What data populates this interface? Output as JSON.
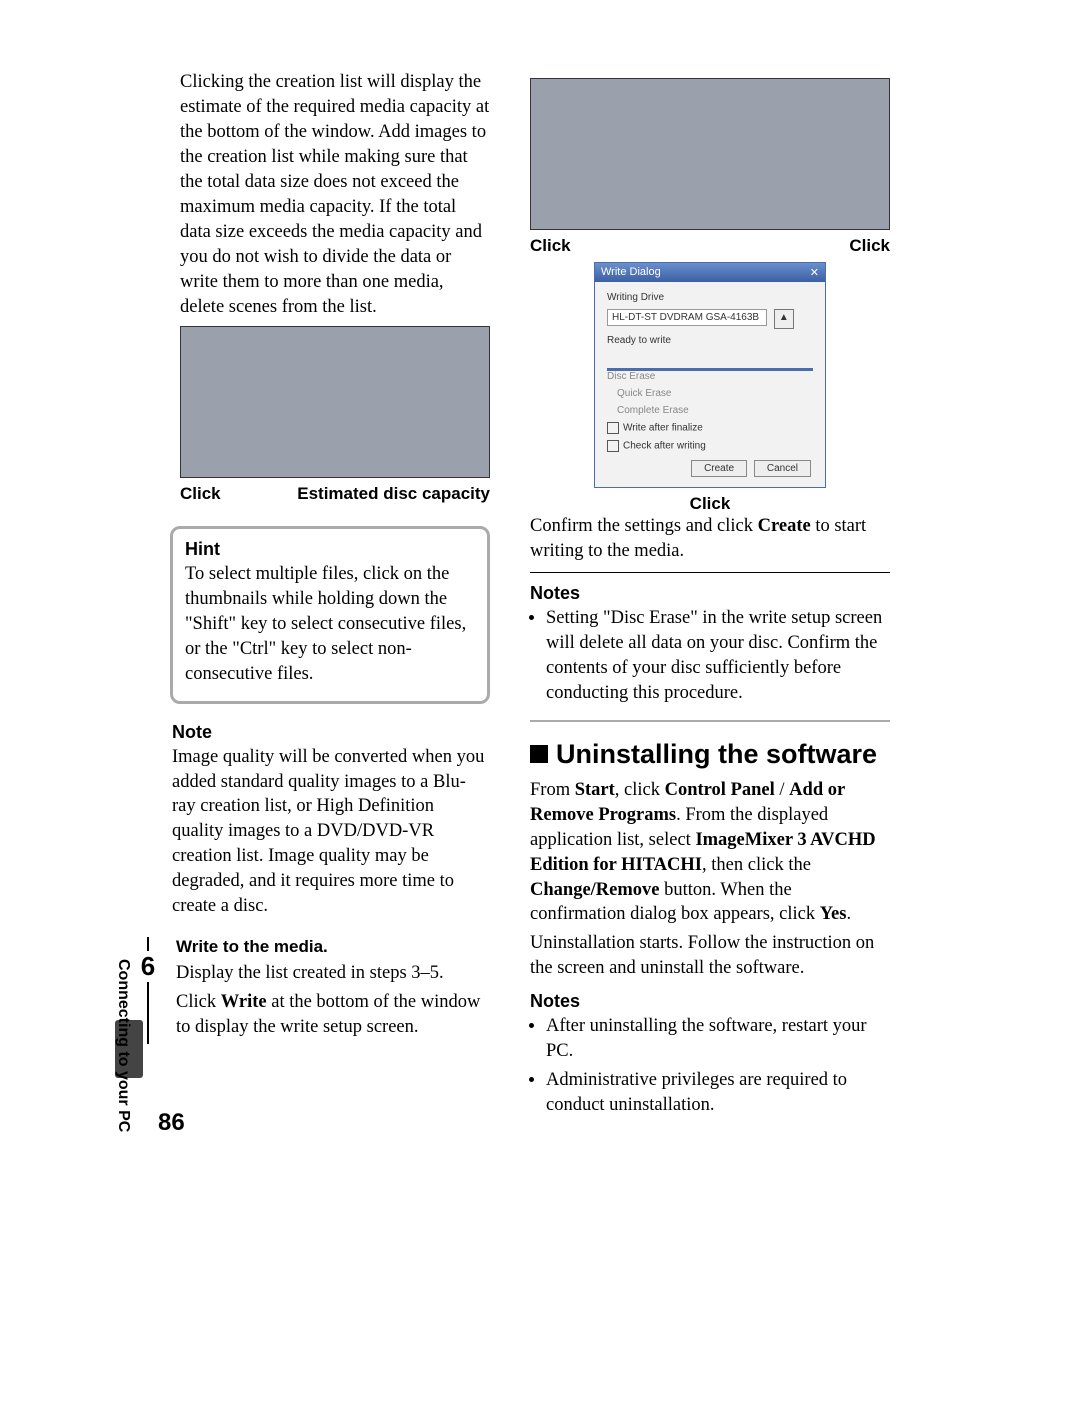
{
  "page_number": "86",
  "side_label": "Connecting to your PC",
  "left_column": {
    "intro": "Clicking the creation list will display the estimate of the required media capacity at the bottom of the window. Add images to the creation list while making sure that the total data size does not exceed the maximum media capacity. If the total data size exceeds the media capacity and you do not wish to divide the data or write them to more than one media, delete scenes from the list.",
    "fig1_caption_left": "Click",
    "fig1_caption_right": "Estimated disc capacity",
    "hint_title": "Hint",
    "hint_text": "To select multiple files, click on the thumbnails while holding down the \"Shift\" key to select consecutive files, or the \"Ctrl\" key to select non-consecutive files.",
    "note_title": "Note",
    "note_text": "Image quality will be converted when you added standard quality images to a Blu-ray creation list, or High Definition quality images to a DVD/DVD-VR creation list. Image quality may be degraded, and it requires more time to create a disc.",
    "step6_num": "6",
    "step6_title": "Write to the media.",
    "step6_line1": "Display the list created in steps 3–5.",
    "step6_line2a": "Click ",
    "step6_line2b": "Write",
    "step6_line2c": " at the bottom of the window to display the write setup screen."
  },
  "right_column": {
    "fig2_caption_left": "Click",
    "fig2_caption_right": "Click",
    "dialog_title": "Write Dialog",
    "dialog_label1": "Writing Drive",
    "dialog_drive": "HL-DT-ST DVDRAM GSA-4163B",
    "dialog_status": "Ready to write",
    "dialog_section": "Disc Erase",
    "dialog_opt1": "Quick Erase",
    "dialog_opt2": "Complete Erase",
    "dialog_cb1": "Write after finalize",
    "dialog_cb2": "Check after writing",
    "dialog_btn1": "Create",
    "dialog_btn2": "Cancel",
    "dialog_caption": "Click",
    "confirm_a": "Confirm the settings and click ",
    "confirm_b": "Create",
    "confirm_c": " to start writing to the media.",
    "notes1_title": "Notes",
    "notes1_item": "Setting \"Disc Erase\" in the write setup screen will delete all data on your disc. Confirm the contents of your disc sufficiently before conducting this procedure.",
    "section_title": "Uninstalling the software",
    "uninstall_p1a": "From ",
    "uninstall_p1b": "Start",
    "uninstall_p1c": ", click ",
    "uninstall_p1d": "Control Panel",
    "uninstall_p1e": " / ",
    "uninstall_p1f": "Add or Remove Programs",
    "uninstall_p1g": ". From the displayed application list, select ",
    "uninstall_p1h": "ImageMixer 3 AVCHD Edition for HITACHI",
    "uninstall_p1i": ", then click the ",
    "uninstall_p1j": "Change/Remove",
    "uninstall_p1k": " button. When the confirmation dialog box appears, click ",
    "uninstall_p1l": "Yes",
    "uninstall_p1m": ".",
    "uninstall_p2": "Uninstallation starts. Follow the instruction on the screen and uninstall the software.",
    "notes2_title": "Notes",
    "notes2_item1": "After uninstalling the software, restart your PC.",
    "notes2_item2": "Administrative privileges are required to conduct uninstallation."
  }
}
